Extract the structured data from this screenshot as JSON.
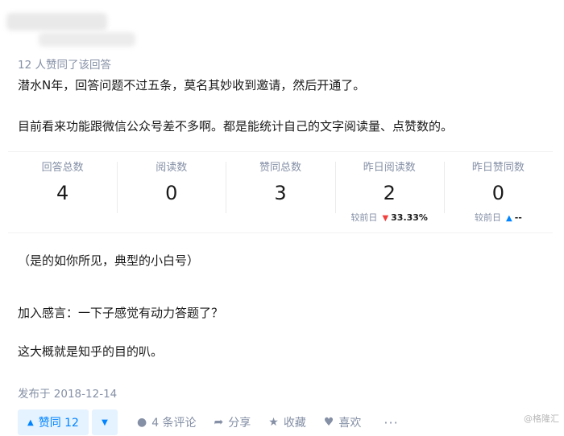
{
  "answer": {
    "endorsement_count_text": "12 人赞同了该回答",
    "paragraphs": [
      "潜水N年，回答问题不过五条，莫名其妙收到邀请，然后开通了。",
      "目前看来功能跟微信公众号差不多啊。都是能统计自己的文字阅读量、点赞数的。",
      "（是的如你所见，典型的小白号）",
      "加入感言：一下子感觉有动力答题了？",
      "这大概就是知乎的目的叭。"
    ],
    "published": "发布于 2018-12-14"
  },
  "stats": [
    {
      "label": "回答总数",
      "value": "4"
    },
    {
      "label": "阅读数",
      "value": "0"
    },
    {
      "label": "赞同总数",
      "value": "3"
    },
    {
      "label": "昨日阅读数",
      "value": "2",
      "compare_label": "较前日",
      "compare_value": "33.33%",
      "trend": "down"
    },
    {
      "label": "昨日赞同数",
      "value": "0",
      "compare_label": "较前日",
      "compare_value": "--",
      "trend": "up"
    }
  ],
  "actions": {
    "upvote": "赞同 12",
    "comments": "4 条评论",
    "share": "分享",
    "collect": "收藏",
    "like": "喜欢",
    "more": "···"
  },
  "colors": {
    "accent": "#0084ff",
    "muted": "#8590a6",
    "down": "#f1403c"
  },
  "watermark": "@格隆汇"
}
